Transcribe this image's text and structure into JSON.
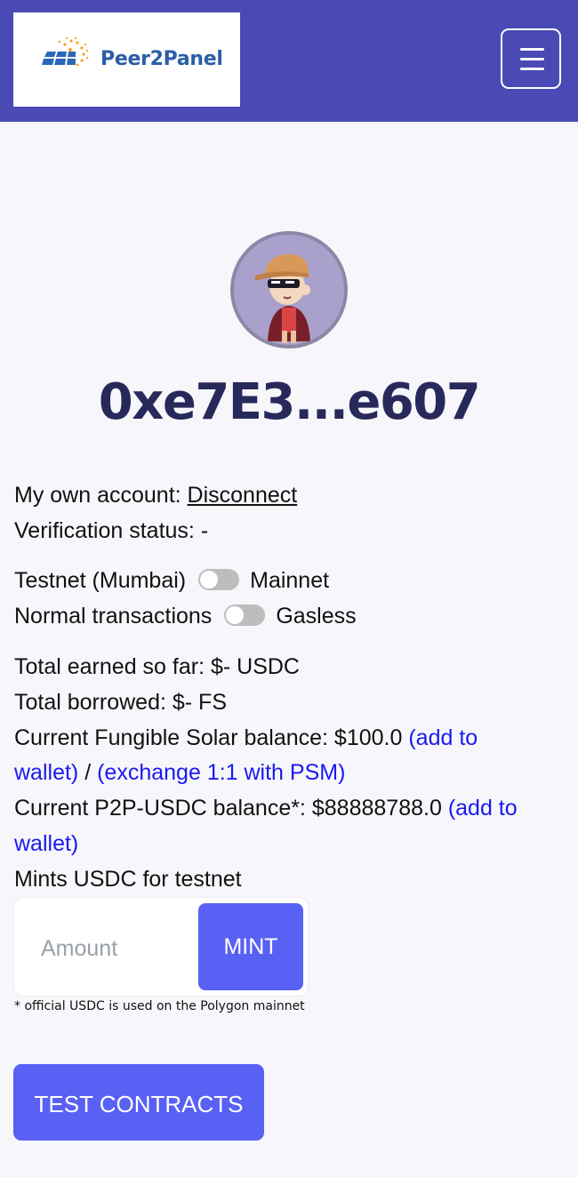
{
  "header": {
    "logo_text": "Peer2Panel",
    "menu_icon": "hamburger-menu-icon"
  },
  "profile": {
    "avatar_icon": "cartoon-avatar",
    "address": "0xe7E3...e607"
  },
  "account": {
    "own_account_label": "My own account:",
    "disconnect_label": "Disconnect",
    "verification_label": "Verification status: -"
  },
  "toggles": {
    "network_left": "Testnet (Mumbai)",
    "network_right": "Mainnet",
    "tx_left": "Normal transactions",
    "tx_right": "Gasless"
  },
  "balances": {
    "total_earned": "Total earned so far: $- USDC",
    "total_borrowed": "Total borrowed: $- FS",
    "fs_balance": "Current Fungible Solar balance: $100.0",
    "add_to": "(add to",
    "wallet_close": "wallet)",
    "slash": " / ",
    "exchange": "(exchange 1:1 with PSM)",
    "usdc_balance": "Current P2P-USDC balance*: $88888788.0",
    "mints_label": "Mints USDC for testnet"
  },
  "mint": {
    "amount_placeholder": "Amount",
    "mint_label": "MINT"
  },
  "footnote": "* official USDC is used on the Polygon mainnet",
  "test_contracts_label": "TEST CONTRACTS",
  "colors": {
    "navbar": "#4a4ab4",
    "accent": "#5861f3",
    "link": "#1a1aee",
    "address": "#27295a"
  }
}
